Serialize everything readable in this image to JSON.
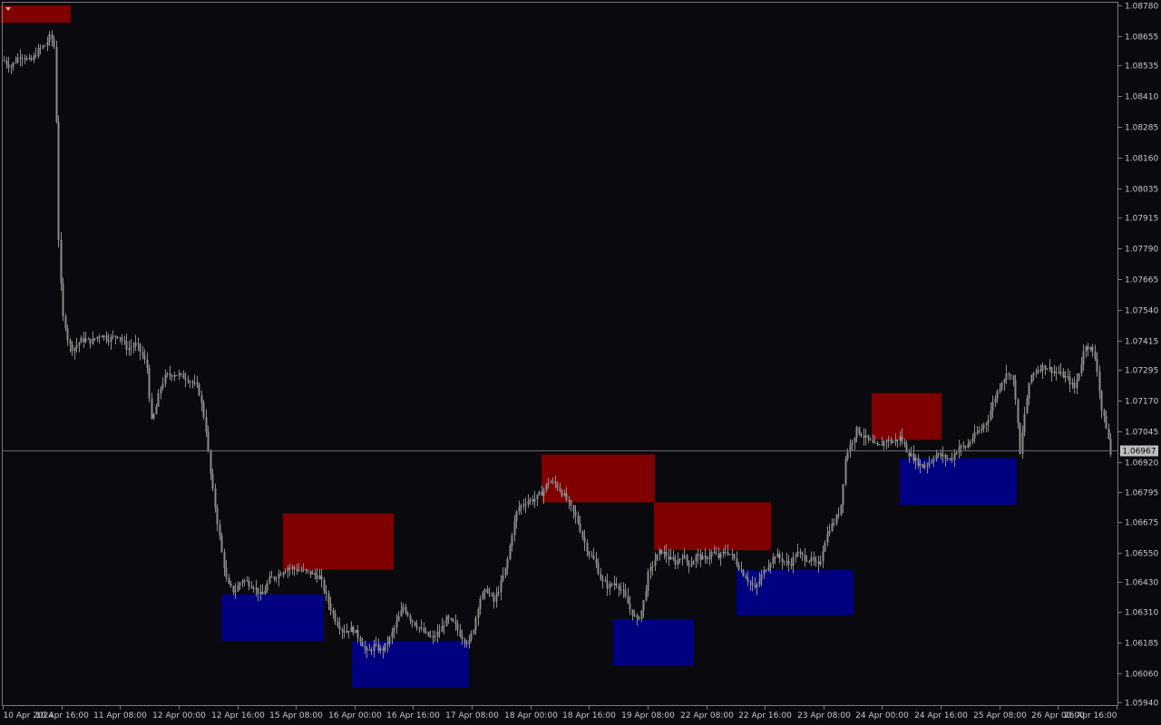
{
  "chart_data": {
    "type": "candlestick",
    "instrument_timeframe": "H1",
    "colors": {
      "background": "#0a0a0e",
      "frame": "#7a7a7a",
      "candle": "#8c8c8c",
      "supply_zone": "#800000",
      "demand_zone": "#000080",
      "current_price_line": "#6a6a6a",
      "current_price_box": "#bfbfbf"
    },
    "ylim": [
      1.0594,
      1.0878
    ],
    "y_ticks": [
      "1.08780",
      "1.08655",
      "1.08535",
      "1.08410",
      "1.08285",
      "1.08160",
      "1.08035",
      "1.07915",
      "1.07790",
      "1.07665",
      "1.07540",
      "1.07415",
      "1.07295",
      "1.07170",
      "1.07045",
      "1.06920",
      "1.06795",
      "1.06675",
      "1.06550",
      "1.06430",
      "1.06310",
      "1.06185",
      "1.06060",
      "1.05940"
    ],
    "x_ticks": [
      "10 Apr 2024",
      "10 Apr 16:00",
      "11 Apr 08:00",
      "12 Apr 00:00",
      "12 Apr 16:00",
      "15 Apr 08:00",
      "16 Apr 00:00",
      "16 Apr 16:00",
      "17 Apr 08:00",
      "18 Apr 00:00",
      "18 Apr 16:00",
      "19 Apr 08:00",
      "22 Apr 08:00",
      "22 Apr 16:00",
      "23 Apr 08:00",
      "24 Apr 00:00",
      "24 Apr 16:00",
      "25 Apr 08:00",
      "26 Apr 00:00",
      "26 Apr 16:00"
    ],
    "current_price": 1.06967,
    "current_price_label": "1.06967",
    "price_path": [
      [
        0,
        1.0857
      ],
      [
        11,
        1.0853
      ],
      [
        22,
        1.0858
      ],
      [
        33,
        1.0855
      ],
      [
        42,
        1.086
      ],
      [
        50,
        1.0862
      ],
      [
        55,
        1.0866
      ],
      [
        60,
        1.086
      ],
      [
        64,
        1.0783
      ],
      [
        68,
        1.0752
      ],
      [
        72,
        1.0747
      ],
      [
        75,
        1.074
      ],
      [
        80,
        1.0738
      ],
      [
        90,
        1.0742
      ],
      [
        100,
        1.0741
      ],
      [
        110,
        1.0744
      ],
      [
        120,
        1.0742
      ],
      [
        130,
        1.0744
      ],
      [
        140,
        1.0738
      ],
      [
        150,
        1.074
      ],
      [
        158,
        1.0734
      ],
      [
        162,
        1.073
      ],
      [
        166,
        1.0708
      ],
      [
        170,
        1.0712
      ],
      [
        176,
        1.0722
      ],
      [
        182,
        1.0727
      ],
      [
        192,
        1.0728
      ],
      [
        206,
        1.0726
      ],
      [
        218,
        1.0722
      ],
      [
        226,
        1.0707
      ],
      [
        232,
        1.0685
      ],
      [
        238,
        1.067
      ],
      [
        244,
        1.0655
      ],
      [
        250,
        1.0642
      ],
      [
        258,
        1.0639
      ],
      [
        266,
        1.0644
      ],
      [
        272,
        1.0643
      ],
      [
        280,
        1.0641
      ],
      [
        288,
        1.0637
      ],
      [
        296,
        1.0644
      ],
      [
        306,
        1.0646
      ],
      [
        316,
        1.0649
      ],
      [
        328,
        1.0648
      ],
      [
        340,
        1.0647
      ],
      [
        352,
        1.0645
      ],
      [
        362,
        1.0634
      ],
      [
        370,
        1.0627
      ],
      [
        378,
        1.0623
      ],
      [
        388,
        1.0624
      ],
      [
        396,
        1.062
      ],
      [
        404,
        1.0614
      ],
      [
        412,
        1.0617
      ],
      [
        420,
        1.0615
      ],
      [
        428,
        1.0619
      ],
      [
        436,
        1.0626
      ],
      [
        444,
        1.0633
      ],
      [
        452,
        1.0628
      ],
      [
        460,
        1.0625
      ],
      [
        468,
        1.0622
      ],
      [
        476,
        1.062
      ],
      [
        484,
        1.0623
      ],
      [
        492,
        1.0628
      ],
      [
        500,
        1.0626
      ],
      [
        508,
        1.0621
      ],
      [
        516,
        1.0618
      ],
      [
        522,
        1.0625
      ],
      [
        528,
        1.0636
      ],
      [
        536,
        1.064
      ],
      [
        544,
        1.0635
      ],
      [
        552,
        1.0643
      ],
      [
        558,
        1.065
      ],
      [
        564,
        1.0663
      ],
      [
        570,
        1.0673
      ],
      [
        580,
        1.0676
      ],
      [
        590,
        1.0677
      ],
      [
        598,
        1.068
      ],
      [
        604,
        1.0684
      ],
      [
        612,
        1.0683
      ],
      [
        620,
        1.0679
      ],
      [
        628,
        1.0674
      ],
      [
        636,
        1.0668
      ],
      [
        642,
        1.0661
      ],
      [
        648,
        1.0655
      ],
      [
        656,
        1.0651
      ],
      [
        662,
        1.0644
      ],
      [
        670,
        1.0641
      ],
      [
        678,
        1.0643
      ],
      [
        686,
        1.0639
      ],
      [
        694,
        1.0632
      ],
      [
        702,
        1.0627
      ],
      [
        708,
        1.0633
      ],
      [
        714,
        1.0646
      ],
      [
        720,
        1.0651
      ],
      [
        728,
        1.0656
      ],
      [
        736,
        1.0653
      ],
      [
        744,
        1.0651
      ],
      [
        752,
        1.0654
      ],
      [
        760,
        1.065
      ],
      [
        768,
        1.0654
      ],
      [
        776,
        1.0652
      ],
      [
        784,
        1.0655
      ],
      [
        792,
        1.0653
      ],
      [
        800,
        1.0656
      ],
      [
        808,
        1.0653
      ],
      [
        816,
        1.0648
      ],
      [
        824,
        1.0644
      ],
      [
        832,
        1.064
      ],
      [
        838,
        1.0645
      ],
      [
        846,
        1.065
      ],
      [
        854,
        1.0654
      ],
      [
        862,
        1.0652
      ],
      [
        870,
        1.065
      ],
      [
        878,
        1.0655
      ],
      [
        886,
        1.0653
      ],
      [
        894,
        1.0652
      ],
      [
        902,
        1.0649
      ],
      [
        908,
        1.0659
      ],
      [
        914,
        1.0665
      ],
      [
        920,
        1.0668
      ],
      [
        926,
        1.0673
      ],
      [
        932,
        1.0695
      ],
      [
        938,
        1.07
      ],
      [
        944,
        1.0705
      ],
      [
        950,
        1.0703
      ],
      [
        956,
        1.0701
      ],
      [
        962,
        1.0699
      ],
      [
        968,
        1.0698
      ],
      [
        976,
        1.0701
      ],
      [
        984,
        1.07
      ],
      [
        992,
        1.0702
      ],
      [
        1000,
        1.0696
      ],
      [
        1008,
        1.0693
      ],
      [
        1016,
        1.069
      ],
      [
        1024,
        1.0692
      ],
      [
        1032,
        1.0695
      ],
      [
        1040,
        1.0694
      ],
      [
        1048,
        1.0693
      ],
      [
        1056,
        1.0698
      ],
      [
        1064,
        1.0698
      ],
      [
        1072,
        1.0702
      ],
      [
        1080,
        1.0705
      ],
      [
        1088,
        1.0709
      ],
      [
        1096,
        1.0718
      ],
      [
        1104,
        1.0725
      ],
      [
        1112,
        1.0729
      ],
      [
        1118,
        1.0723
      ],
      [
        1124,
        1.0695
      ],
      [
        1130,
        1.0715
      ],
      [
        1136,
        1.0727
      ],
      [
        1144,
        1.073
      ],
      [
        1152,
        1.0731
      ],
      [
        1160,
        1.0729
      ],
      [
        1168,
        1.0728
      ],
      [
        1176,
        1.0726
      ],
      [
        1184,
        1.0722
      ],
      [
        1190,
        1.073
      ],
      [
        1196,
        1.074
      ],
      [
        1202,
        1.0738
      ],
      [
        1208,
        1.0733
      ],
      [
        1214,
        1.0713
      ],
      [
        1220,
        1.0705
      ],
      [
        1224,
        1.0695
      ]
    ],
    "zones": [
      {
        "kind": "supply",
        "t0": 1,
        "t1": 78,
        "y_top": 1.0878,
        "y_bottom": 1.0871
      },
      {
        "kind": "supply",
        "t0": 312,
        "t1": 434,
        "y_top": 1.0671,
        "y_bottom": 1.0648
      },
      {
        "kind": "supply",
        "t0": 597,
        "t1": 722,
        "y_top": 1.0695,
        "y_bottom": 1.06755
      },
      {
        "kind": "supply",
        "t0": 721,
        "t1": 850,
        "y_top": 1.06755,
        "y_bottom": 1.0656
      },
      {
        "kind": "supply",
        "t0": 961,
        "t1": 1038,
        "y_top": 1.072,
        "y_bottom": 1.0701
      },
      {
        "kind": "demand",
        "t0": 244,
        "t1": 357,
        "y_top": 1.0638,
        "y_bottom": 1.0619
      },
      {
        "kind": "demand",
        "t0": 388,
        "t1": 517,
        "y_top": 1.0619,
        "y_bottom": 1.06
      },
      {
        "kind": "demand",
        "t0": 676,
        "t1": 765,
        "y_top": 1.0628,
        "y_bottom": 1.0609
      },
      {
        "kind": "demand",
        "t0": 812,
        "t1": 941,
        "y_top": 1.0648,
        "y_bottom": 1.06295
      },
      {
        "kind": "demand",
        "t0": 992,
        "t1": 1121,
        "y_top": 1.06935,
        "y_bottom": 1.06745
      }
    ]
  }
}
